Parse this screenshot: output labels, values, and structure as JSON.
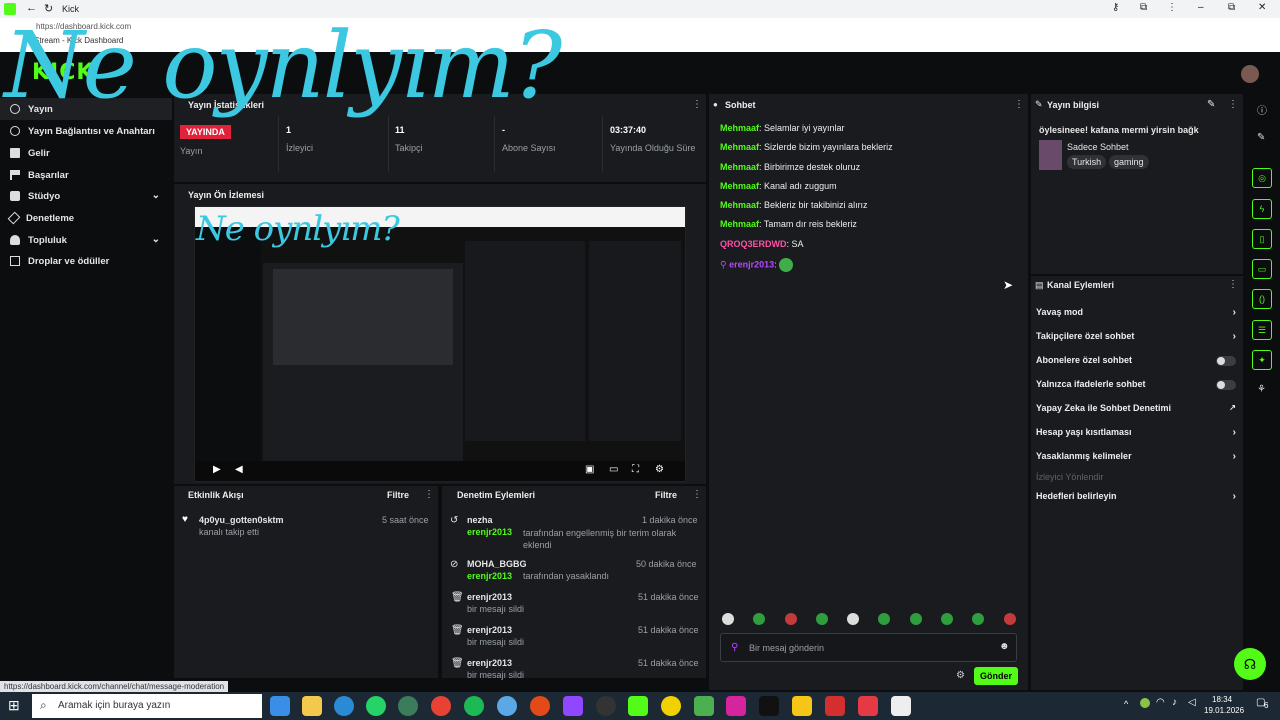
{
  "browser": {
    "tab_title": "Kick",
    "url": "https://dashboard.kick.com",
    "page_title": "Stream - Kick Dashboard",
    "status_url": "https://dashboard.kick.com/channel/chat/message-moderation"
  },
  "overlay_text": "Ne oynlyım?",
  "brand": {
    "logo": "KICK",
    "accent": "#53fc18"
  },
  "sidebar": {
    "items": [
      {
        "label": "Yayın",
        "icon": "broadcast-icon"
      },
      {
        "label": "Yayın Bağlantısı ve Anahtarı",
        "icon": "link-icon"
      },
      {
        "label": "Gelir",
        "icon": "revenue-icon"
      },
      {
        "label": "Başarılar",
        "icon": "flag-icon"
      },
      {
        "label": "Stüdyo",
        "icon": "studio-icon"
      },
      {
        "label": "Denetleme",
        "icon": "wrench-icon"
      },
      {
        "label": "Topluluk",
        "icon": "community-icon"
      },
      {
        "label": "Droplar ve ödüller",
        "icon": "gift-icon"
      }
    ]
  },
  "stats": {
    "title": "Yayın İstatistikleri",
    "live_badge": "YAYINDA",
    "items": [
      {
        "value": "",
        "label": "Yayın"
      },
      {
        "value": "1",
        "label": "İzleyici"
      },
      {
        "value": "11",
        "label": "Takipçi"
      },
      {
        "value": "-",
        "label": "Abone Sayısı"
      },
      {
        "value": "03:37:40",
        "label": "Yayında Olduğu Süre"
      }
    ]
  },
  "preview": {
    "title": "Yayın Ön İzlemesi"
  },
  "activity": {
    "title": "Etkinlik Akışı",
    "filter": "Filtre",
    "items": [
      {
        "user": "4p0yu_gotten0sktm",
        "text": "kanalı takip etti",
        "time": "5 saat önce"
      }
    ]
  },
  "moderation": {
    "title": "Denetim Eylemleri",
    "filter": "Filtre",
    "items": [
      {
        "user": "nezha",
        "actor": "erenjr2013",
        "text": "tarafından engellenmiş bir terim olarak eklendi",
        "time": "1 dakika önce"
      },
      {
        "user": "MOHA_BGBG",
        "actor": "erenjr2013",
        "text": "tarafından yasaklandı",
        "time": "50 dakika önce"
      },
      {
        "user": "erenjr2013",
        "actor": "",
        "text": "bir mesajı sildi",
        "time": "51 dakika önce"
      },
      {
        "user": "erenjr2013",
        "actor": "",
        "text": "bir mesajı sildi",
        "time": "51 dakika önce"
      },
      {
        "user": "erenjr2013",
        "actor": "",
        "text": "bir mesajı sildi",
        "time": "51 dakika önce"
      }
    ]
  },
  "chat": {
    "title": "Sohbet",
    "messages": [
      {
        "user": "Mehmaaf",
        "text": "Selamlar iyi yayınlar"
      },
      {
        "user": "Mehmaaf",
        "text": "Sizlerde bizim yayınlara bekleriz"
      },
      {
        "user": "Mehmaaf",
        "text": "Birbirimze destek oluruz"
      },
      {
        "user": "Mehmaaf",
        "text": "Kanal adı zuggum"
      },
      {
        "user": "Mehmaaf",
        "text": "Bekleriz bir takibinizi alırız"
      },
      {
        "user": "Mehmaaf",
        "text": "Tamam dır reis bekleriz"
      },
      {
        "user": "QROQ3ERDWD",
        "text": "SA"
      },
      {
        "user": "erenjr2013",
        "text": ""
      }
    ],
    "input_placeholder": "Bir mesaj gönderin",
    "send_label": "Gönder"
  },
  "stream_info": {
    "title": "Yayın bilgisi",
    "stream_title": "öylesineee! kafana mermi yirsin bağk",
    "category": "Sadece Sohbet",
    "tags": [
      "Turkish",
      "gaming"
    ]
  },
  "channel_actions": {
    "title": "Kanal Eylemleri",
    "items": [
      {
        "label": "Yavaş mod",
        "control": "chevron"
      },
      {
        "label": "Takipçilere özel sohbet",
        "control": "chevron"
      },
      {
        "label": "Abonelere özel sohbet",
        "control": "toggle"
      },
      {
        "label": "Yalnızca ifadelerle sohbet",
        "control": "toggle"
      },
      {
        "label": "Yapay Zeka ile Sohbet Denetimi",
        "control": "external"
      },
      {
        "label": "Hesap yaşı kısıtlaması",
        "control": "chevron"
      },
      {
        "label": "Yasaklanmış kelimeler",
        "control": "chevron"
      }
    ],
    "section_label": "İzleyici Yönlendir",
    "goals_label": "Hedefleri belirleyin"
  },
  "taskbar": {
    "search_placeholder": "Aramak için buraya yazın",
    "time": "18:34",
    "date": "19.01.2026",
    "notif_count": "6"
  }
}
